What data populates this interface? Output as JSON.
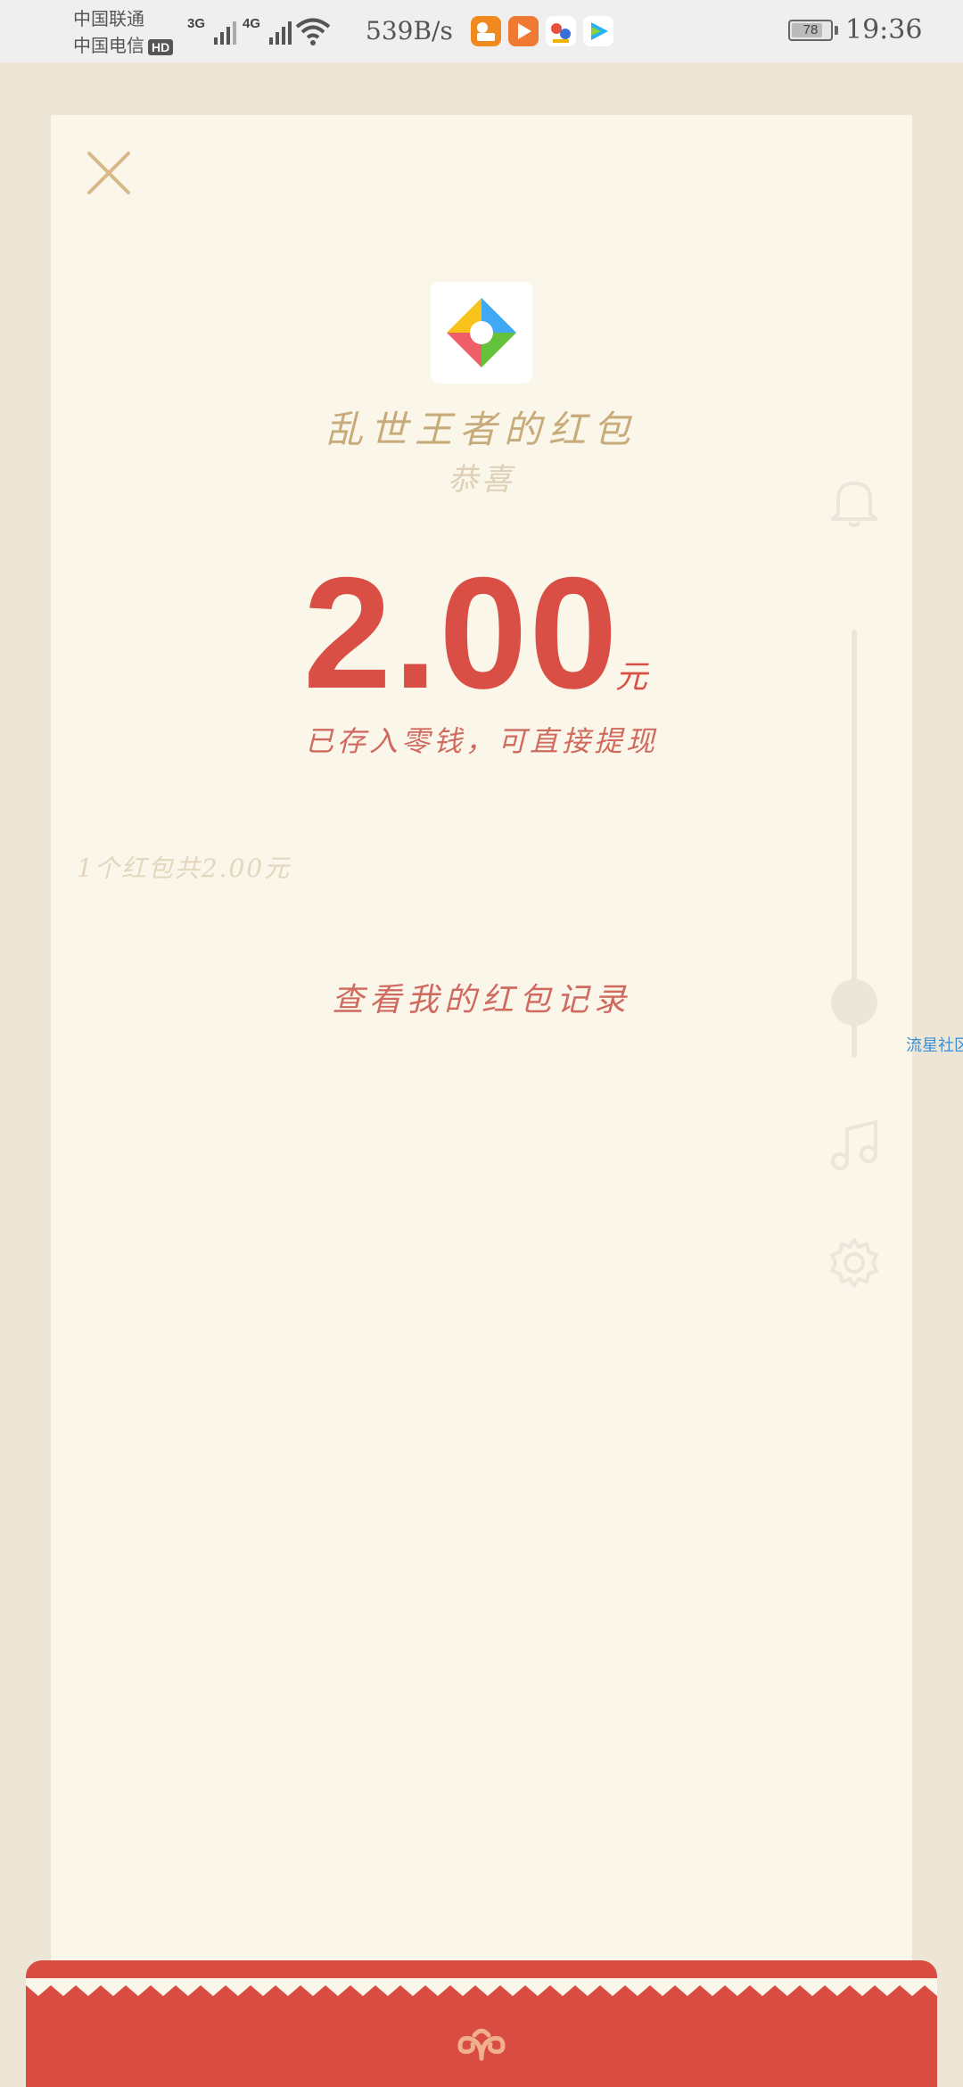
{
  "status_bar": {
    "carrier_1": "中国联通",
    "carrier_2": "中国电信",
    "hd_badge": "HD",
    "signal_1_type": "3G",
    "signal_2_type": "4G",
    "net_speed": "539B/s",
    "battery_level": 78,
    "battery_text": "78",
    "time": "19:36"
  },
  "red_packet": {
    "sender_title": "乱世王者的红包",
    "greeting": "恭喜",
    "amount": "2.00",
    "unit": "元",
    "stored_note": "已存入零钱，可直接提现",
    "summary": "1个红包共2.00元",
    "record_link": "查看我的红包记录"
  },
  "floating_widget": {
    "label": "流星社区"
  },
  "colors": {
    "accent_red": "#d94f45",
    "gold": "#c7ab7a",
    "card_bg": "#fbf6ea",
    "page_bg": "#ede6d6"
  },
  "icons": [
    "close-icon",
    "app-logo-icon",
    "bell-icon",
    "music-icon",
    "gear-icon",
    "footer-ornament-icon"
  ]
}
